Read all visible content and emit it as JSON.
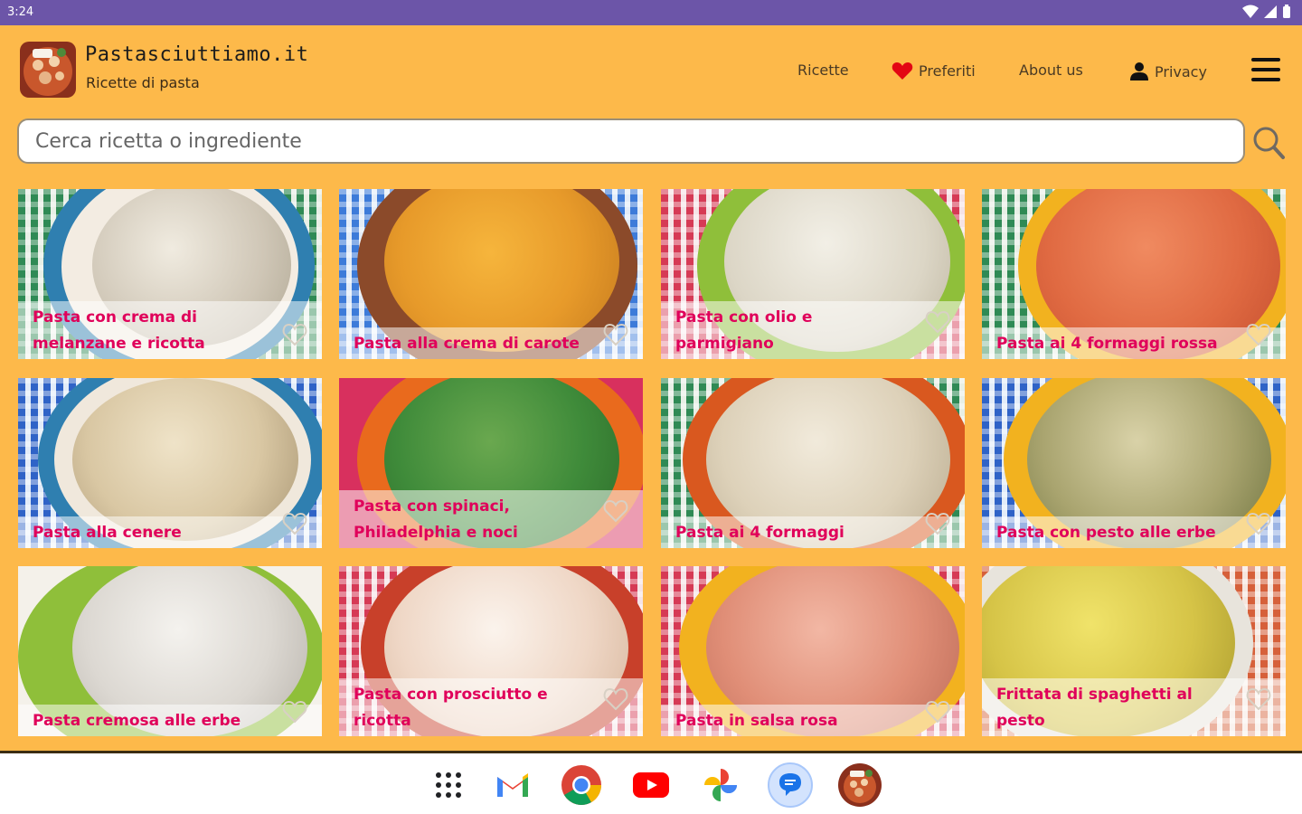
{
  "status_bar": {
    "time": "3:24",
    "icons": [
      "wifi-icon",
      "signal-icon",
      "battery-icon"
    ]
  },
  "header": {
    "brand_title": "Pastasciuttiamo.it",
    "brand_subtitle": "Ricette di pasta",
    "nav": {
      "recipes": "Ricette",
      "favorites": "Preferiti",
      "about": "About us",
      "privacy": "Privacy"
    }
  },
  "search": {
    "placeholder": "Cerca ricetta o ingrediente",
    "value": ""
  },
  "colors": {
    "app_background": "#fdb94a",
    "status_bar": "#6c55a8",
    "caption_text": "#e0005a",
    "favorite_heart": "#e30613"
  },
  "recipes": [
    {
      "title": "Pasta con crema di melanzane e ricotta"
    },
    {
      "title": "Pasta alla crema di carote"
    },
    {
      "title": "Pasta con olio e parmigiano"
    },
    {
      "title": "Pasta ai 4 formaggi rossa"
    },
    {
      "title": "Pasta alla cenere"
    },
    {
      "title": "Pasta con spinaci, Philadelphia e noci"
    },
    {
      "title": "Pasta ai 4 formaggi"
    },
    {
      "title": "Pasta con pesto alle erbe"
    },
    {
      "title": "Pasta cremosa alle erbe"
    },
    {
      "title": "Pasta con prosciutto e ricotta"
    },
    {
      "title": "Pasta in salsa rosa"
    },
    {
      "title": "Frittata di spaghetti al pesto"
    }
  ],
  "dock": {
    "apps": [
      "app-drawer-icon",
      "gmail-icon",
      "chrome-icon",
      "youtube-icon",
      "photos-icon",
      "messages-icon",
      "pastasciuttiamo-app-icon"
    ]
  }
}
